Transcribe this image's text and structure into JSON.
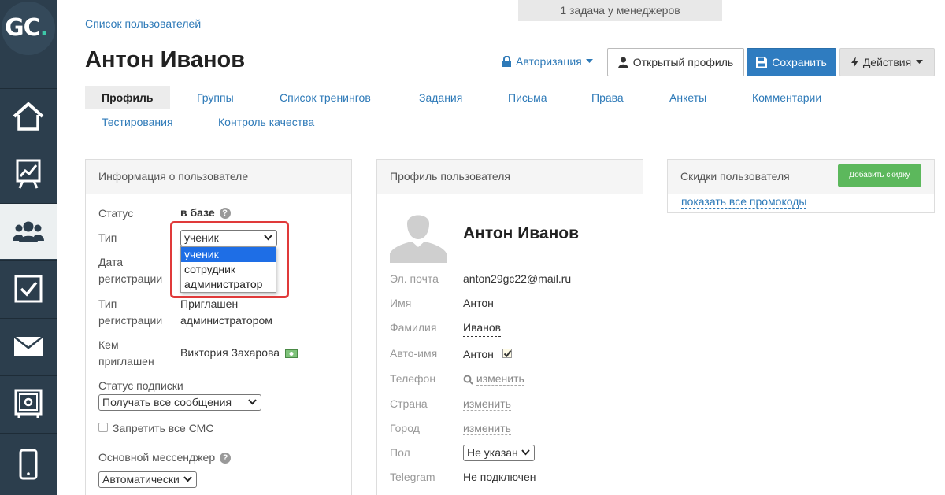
{
  "logo": {
    "text": "GC",
    "dot": "."
  },
  "sidebar": {
    "items": [
      {
        "icon": "home-icon"
      },
      {
        "icon": "chart-board-icon"
      },
      {
        "icon": "users-icon",
        "active": true
      },
      {
        "icon": "checkbox-icon"
      },
      {
        "icon": "mail-icon"
      },
      {
        "icon": "safe-icon"
      },
      {
        "icon": "mobile-icon"
      }
    ]
  },
  "task_notice": "1 задача у менеджеров",
  "breadcrumb": "Список пользователей",
  "title": "Антон Иванов",
  "header": {
    "auth_label": "Авторизация",
    "open_profile_label": "Открытый профиль",
    "save_label": "Сохранить",
    "actions_label": "Действия"
  },
  "tabs": {
    "profile": "Профиль",
    "groups": "Группы",
    "trainings": "Список тренингов",
    "tasks": "Задания",
    "letters": "Письма",
    "rights": "Права",
    "forms": "Анкеты",
    "comments": "Комментарии",
    "testing": "Тестирования",
    "quality": "Контроль качества"
  },
  "info": {
    "title": "Информация о пользователе",
    "status_label": "Статус",
    "status_value": "в базе",
    "type_label": "Тип",
    "type_value": "ученик",
    "type_options": [
      "ученик",
      "сотрудник",
      "администратор"
    ],
    "reg_date_label_1": "Дата",
    "reg_date_label_2": "регистрации",
    "reg_type_label_1": "Тип",
    "reg_type_label_2": "регистрации",
    "reg_type_value_1": "Приглашен",
    "reg_type_value_2": "администратором",
    "invited_label_1": "Кем",
    "invited_label_2": "приглашен",
    "invited_value": "Виктория Захарова",
    "subscription_label": "Статус подписки",
    "subscription_value": "Получать все сообщения",
    "sms_label": "Запретить все СМС",
    "messenger_label": "Основной мессенджер",
    "messenger_value": "Автоматически"
  },
  "profile": {
    "title": "Профиль пользователя",
    "name": "Антон Иванов",
    "email_label": "Эл. почта",
    "email_value": "anton29gc22@mail.ru",
    "first_name_label": "Имя",
    "first_name_value": "Антон",
    "last_name_label": "Фамилия",
    "last_name_value": "Иванов",
    "auto_name_label": "Авто-имя",
    "auto_name_value": "Антон",
    "phone_label": "Телефон",
    "phone_value": "изменить",
    "country_label": "Страна",
    "country_value": "изменить",
    "city_label": "Город",
    "city_value": "изменить",
    "gender_label": "Пол",
    "gender_value": "Не указан",
    "telegram_label": "Telegram",
    "telegram_value": "Не подключен"
  },
  "discounts": {
    "title": "Скидки пользователя",
    "add_label": "Добавить скидку",
    "promo_link": "показать все промокоды"
  }
}
